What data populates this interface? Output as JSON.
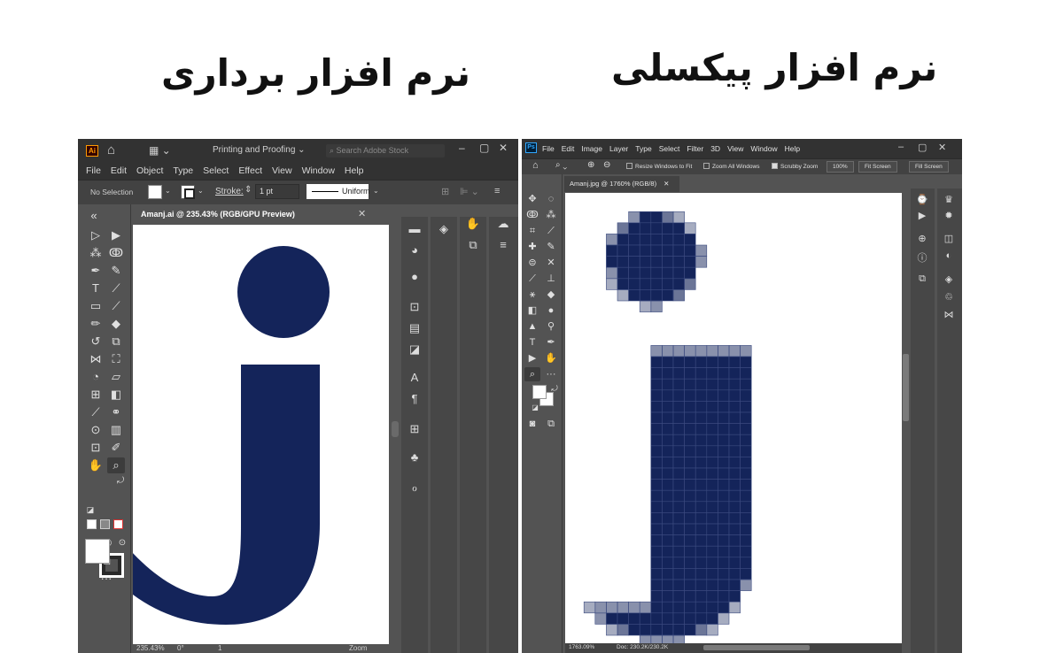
{
  "headings": {
    "left": "نرم افزار برداری",
    "right": "نرم افزار پیکسلی"
  },
  "illustrator": {
    "logo": "Ai",
    "workspace": "Printing and Proofing",
    "search_placeholder": "Search Adobe Stock",
    "menu": [
      "File",
      "Edit",
      "Object",
      "Type",
      "Select",
      "Effect",
      "View",
      "Window",
      "Help"
    ],
    "control": {
      "selection": "No Selection",
      "stroke_label": "Stroke:",
      "stroke_weight": "1 pt",
      "profile": "Uniform"
    },
    "document_tab": "Amanj.ai @ 235.43% (RGB/GPU Preview)",
    "status": {
      "zoom": "235.43%",
      "rotation": "0°",
      "artboard": "1",
      "tool": "Zoom"
    },
    "glyph_color": "#14245a"
  },
  "photoshop": {
    "logo": "Ps",
    "menu": [
      "File",
      "Edit",
      "Image",
      "Layer",
      "Type",
      "Select",
      "Filter",
      "3D",
      "View",
      "Window",
      "Help"
    ],
    "options": {
      "resize": "Resize Windows to Fit",
      "zoom_all": "Zoom All Windows",
      "scrubby": "Scrubby Zoom",
      "percent": "100%",
      "fit1": "Fit Screen",
      "fit2": "Fill Screen"
    },
    "document_tab": "Amanj.jpg @ 1760% (RGB/8)",
    "status": {
      "zoom": "1763.09%",
      "doc": "Doc: 230.2K/230.2K"
    },
    "glyph_color": "#14245a"
  }
}
